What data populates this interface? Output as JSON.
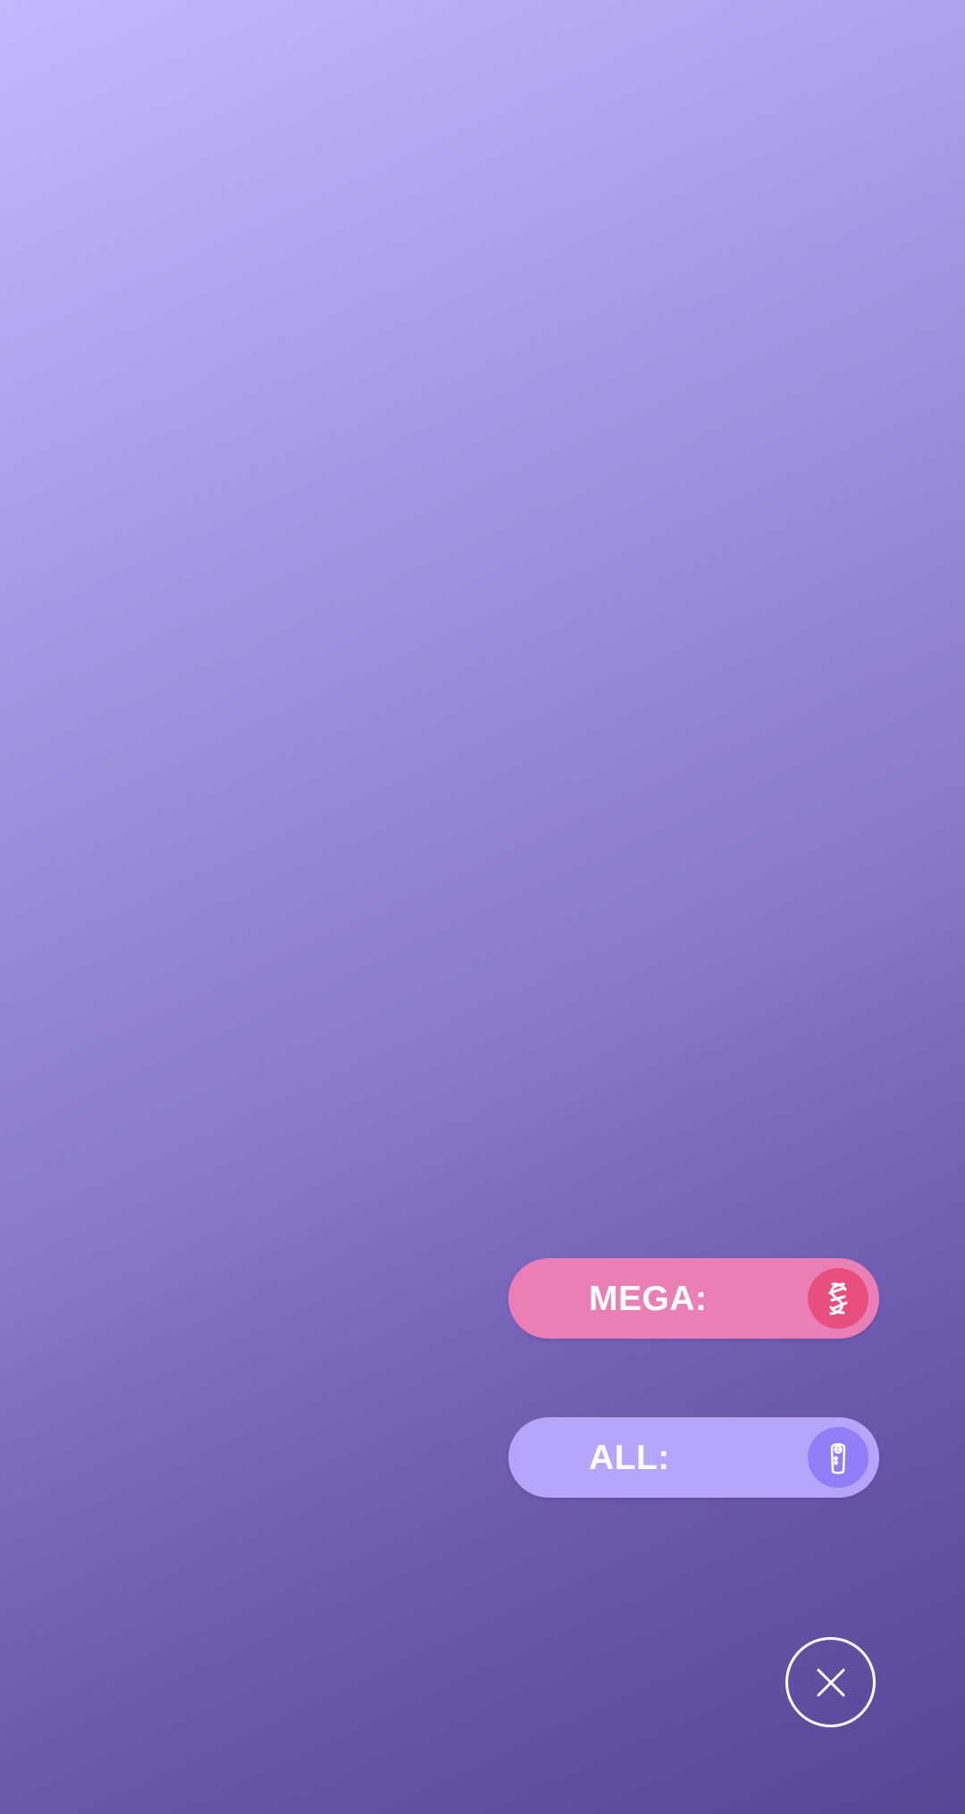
{
  "buttons": [
    {
      "id": "mega",
      "label": "MEGA:",
      "value": "",
      "icon": "mega-energy-icon",
      "color": "#e97fb5",
      "icon_bg": "#e84f7e"
    },
    {
      "id": "all",
      "label": "ALL:",
      "value": "",
      "icon": "raid-pass-icon",
      "color": "#b5a5fb",
      "icon_bg": "#8f7ef8"
    }
  ],
  "close": {
    "icon": "close-icon"
  },
  "theme": {
    "background_top": "#c3b8ff",
    "background_bottom": "#5a4697",
    "text": "#ffffff"
  }
}
